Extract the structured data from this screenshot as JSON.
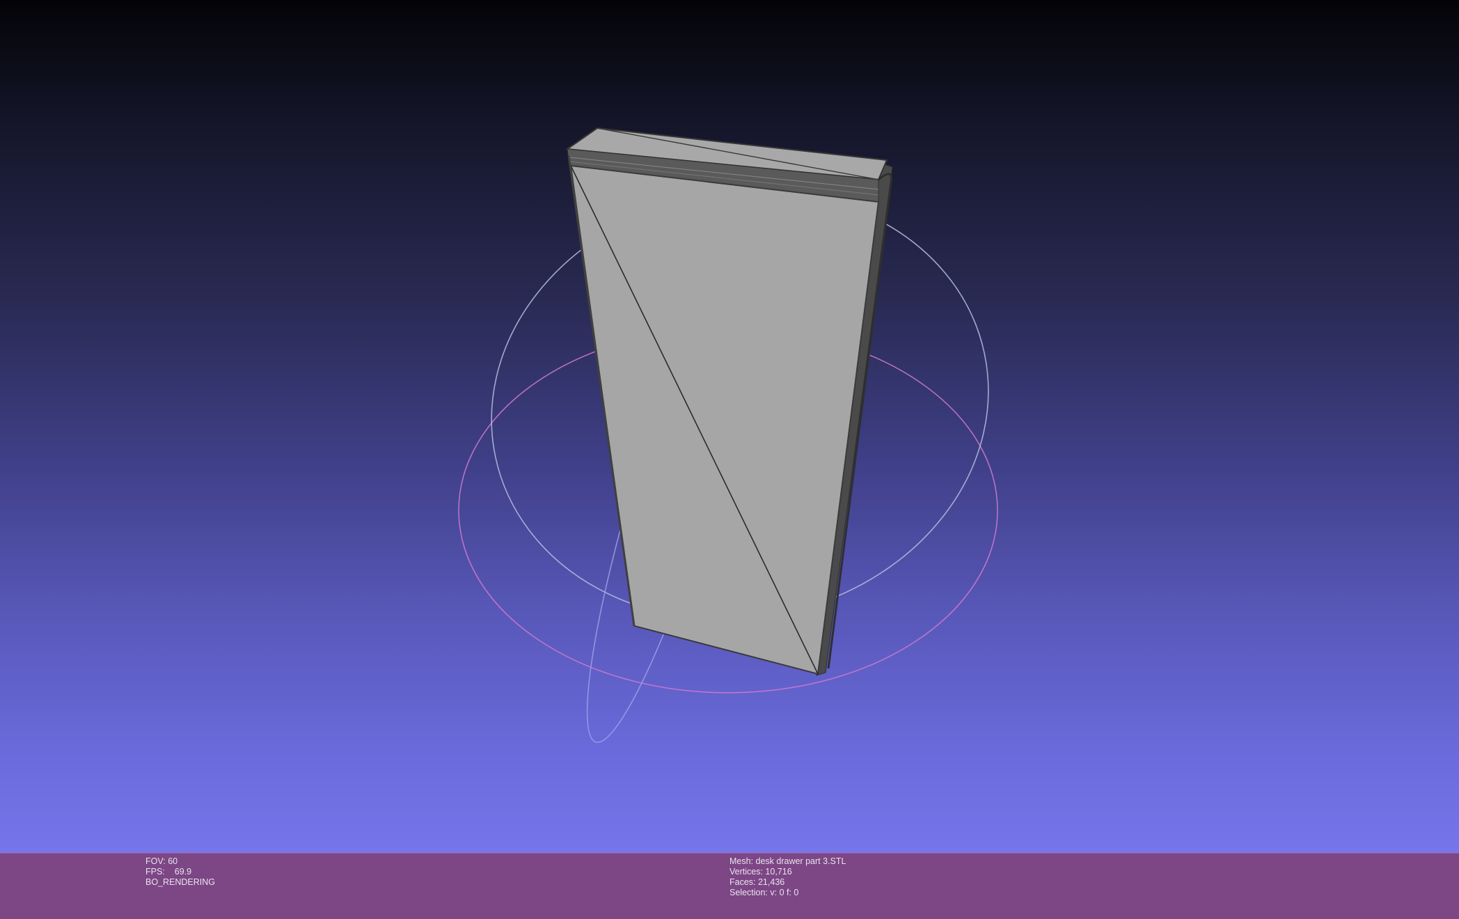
{
  "viewer": {
    "fov_label": "FOV:",
    "fov_value": "60",
    "fps_label": "FPS:",
    "fps_value": "69.9",
    "render_mode": "BO_RENDERING"
  },
  "mesh_info": {
    "mesh_line": "Mesh: desk drawer part 3.STL",
    "vertices_line": "Vertices: 10,716",
    "faces_line": "Faces: 21,436",
    "selection_line": "Selection: v: 0 f: 0"
  },
  "colors": {
    "background_top": "#040407",
    "background_bottom": "#7676ea",
    "info_bar": "#7d4685",
    "mesh_face": "#a6a6a6",
    "mesh_edge": "#3a3a3a",
    "trackball_horizontal": "#d07acb",
    "trackball_vertical": "#9a9ae6",
    "trackball_front": "#b9bfe0"
  }
}
